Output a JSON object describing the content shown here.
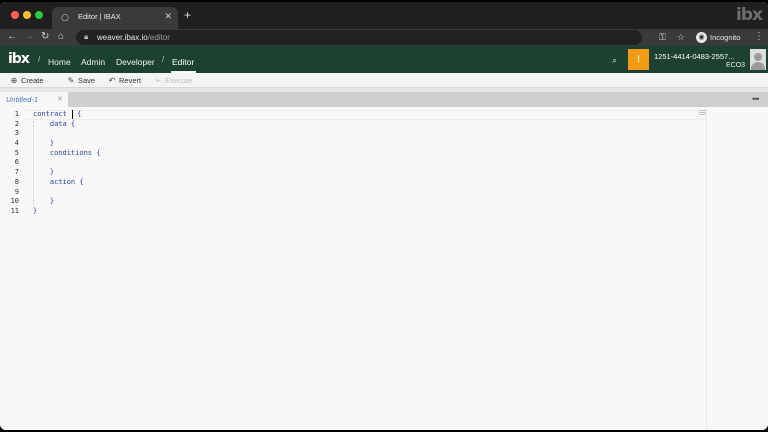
{
  "browser": {
    "tab_title": "Editor | IBAX",
    "url_host": "weaver.ibax.io",
    "url_path": "/editor",
    "incognito_label": "Incognito"
  },
  "header": {
    "logo": "ibx",
    "separator": "/",
    "nav": [
      "Home",
      "Admin",
      "Developer",
      "Editor"
    ],
    "notification_count": "!",
    "account_id": "1251-4414-0483-2557...",
    "ecosystem": "ECO3",
    "colors": {
      "header_bg": "#1d4130",
      "notification": "#f39c12"
    }
  },
  "toolbar": {
    "create_label": "Create",
    "save_label": "Save",
    "revert_label": "Revert",
    "execute_label": "Execute"
  },
  "editor": {
    "tab_title": "Untitled-1",
    "more_icon": "ellipsis-icon",
    "line_numbers": [
      "1",
      "2",
      "3",
      "4",
      "5",
      "6",
      "7",
      "8",
      "9",
      "10",
      "11"
    ],
    "lines": [
      "contract ",
      "    data {",
      "",
      "    }",
      "    conditions {",
      "",
      "    }",
      "    action {",
      "",
      "    }",
      "}"
    ],
    "first_line_tail": " {"
  }
}
